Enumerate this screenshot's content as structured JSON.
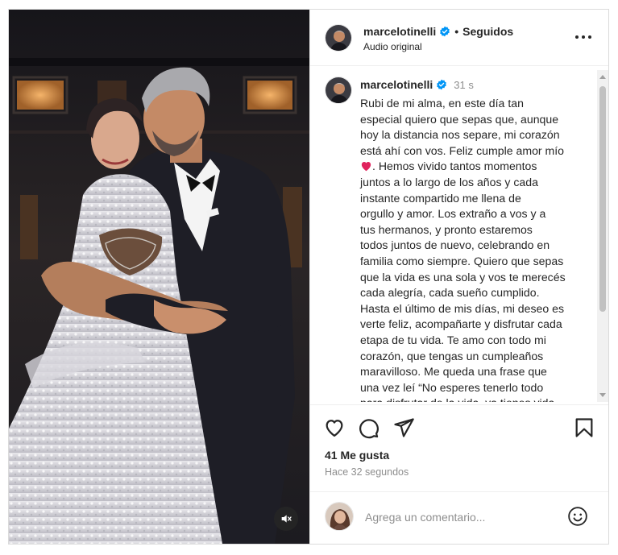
{
  "post": {
    "username": "marcelotinelli",
    "separator": "•",
    "follow_state": "Seguidos",
    "audio": "Audio original",
    "caption_time": "31 s",
    "caption_part1": "Rubi de mi alma, en este día tan\nespecial quiero que sepas que, aunque\nhoy la distancia nos separe, mi corazón\nestá ahí con vos. Feliz cumple amor mío\n",
    "caption_part2": ". Hemos vivido tantos momentos\njuntos  a lo largo de los años y cada\ninstante compartido me llena de\norgullo y amor. Los extraño a vos y a\ntus hermanos, y pronto estaremos\ntodos juntos de nuevo, celebrando en\nfamilia como siempre. Quiero que sepas\nque la vida es una sola y vos te merecés\ncada alegría, cada sueño cumplido.\nHasta el último de mis días, mi deseo es\nverte feliz, acompañarte y disfrutar cada\netapa de tu vida. Te amo con todo mi\ncorazón, que tengas un cumpleaños\nmaravilloso. Me queda una frase que\nuna vez leí “No esperes tenerlo todo\npara disfrutar de la vida, ya tienes vida",
    "likes": "41 Me gusta",
    "time_ago": "Hace 32 segundos",
    "comment_placeholder": "Agrega un comentario..."
  },
  "icons": {
    "more": "more-options-icon",
    "verified": "verified-badge-icon",
    "like": "heart-icon",
    "comment": "comment-icon",
    "share": "share-icon",
    "save": "bookmark-icon",
    "emoji": "emoji-icon",
    "mute": "muted-speaker-icon",
    "caption_emoji": "red-heart-emoji"
  },
  "colors": {
    "verified_blue": "#0095f6",
    "text": "#262626",
    "secondary_text": "#8e8e8e",
    "heart_red": "#e0245e"
  }
}
